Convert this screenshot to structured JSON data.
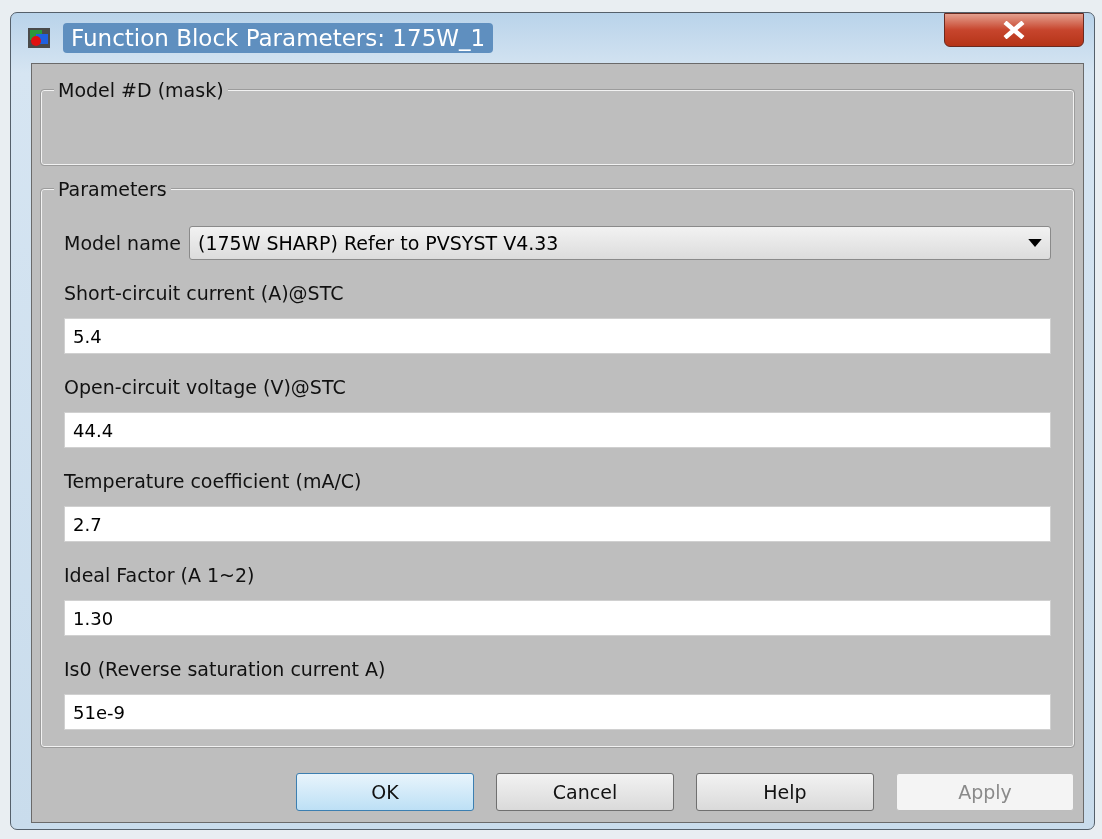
{
  "window": {
    "title": "Function Block Parameters: 175W_1"
  },
  "mask_group": {
    "title": "Model #D (mask)"
  },
  "parameters": {
    "title": "Parameters",
    "model_name": {
      "label": "Model name",
      "value": "(175W SHARP) Refer to PVSYST V4.33"
    },
    "fields": [
      {
        "label": "Short-circuit current (A)@STC",
        "value": "5.4"
      },
      {
        "label": "Open-circuit voltage (V)@STC",
        "value": "44.4"
      },
      {
        "label": "Temperature coefficient (mA/C)",
        "value": "2.7"
      },
      {
        "label": "Ideal Factor (A 1~2)",
        "value": "1.30"
      },
      {
        "label": "Is0 (Reverse saturation current A)",
        "value": "51e-9"
      }
    ]
  },
  "buttons": [
    {
      "label": "OK",
      "default": true,
      "disabled": false
    },
    {
      "label": "Cancel",
      "default": false,
      "disabled": false
    },
    {
      "label": "Help",
      "default": false,
      "disabled": false
    },
    {
      "label": "Apply",
      "default": false,
      "disabled": true
    }
  ]
}
